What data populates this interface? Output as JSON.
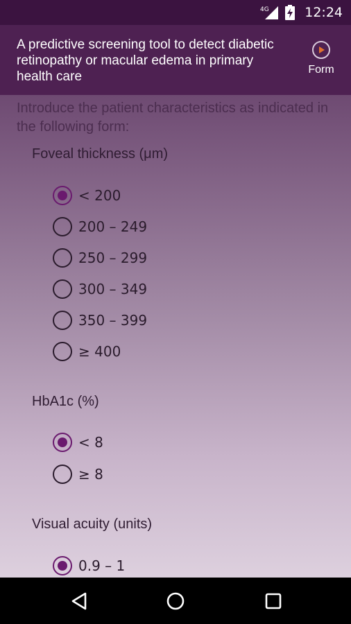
{
  "status_bar": {
    "network": "4G",
    "time": "12:24",
    "icons": [
      "signal-icon",
      "battery-charging-icon"
    ]
  },
  "action_bar": {
    "title": "A predictive screening tool to detect diabetic retinopathy or macular edema in primary health care",
    "form_label": "Form",
    "form_icon": "play-circle-icon",
    "accent_color": "#e0712e"
  },
  "intro": "Introduce the patient characteristics as indicated in the following form:",
  "groups": [
    {
      "label": "Foveal thickness (μm)",
      "options": [
        "< 200",
        "200 – 249",
        "250 – 299",
        "300 – 349",
        "350 – 399",
        "≥ 400"
      ],
      "selected": "< 200"
    },
    {
      "label": "HbA1c (%)",
      "options": [
        "< 8",
        "≥ 8"
      ],
      "selected": "< 8"
    },
    {
      "label": "Visual acuity (units)",
      "options": [
        "0.9 – 1"
      ],
      "selected": "0.9 – 1"
    }
  ],
  "nav": {
    "back_icon": "back-triangle-icon",
    "home_icon": "home-circle-icon",
    "recents_icon": "recents-square-icon"
  },
  "colors": {
    "status_bar": "#3b1340",
    "action_bar": "#4e2152",
    "radio_checked": "#6a1a6e"
  }
}
